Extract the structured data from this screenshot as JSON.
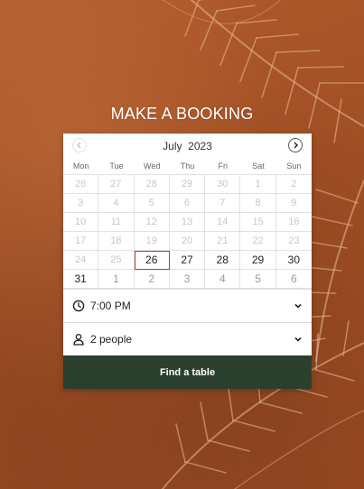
{
  "page": {
    "title": "MAKE A BOOKING"
  },
  "calendar": {
    "month_label": "July  2023",
    "weekdays": [
      "Mon",
      "Tue",
      "Wed",
      "Thu",
      "Fri",
      "Sat",
      "Sun"
    ],
    "days": [
      "26",
      "27",
      "28",
      "29",
      "30",
      "1",
      "2",
      "3",
      "4",
      "5",
      "6",
      "7",
      "8",
      "9",
      "10",
      "11",
      "12",
      "13",
      "14",
      "15",
      "16",
      "17",
      "18",
      "19",
      "20",
      "21",
      "22",
      "23",
      "24",
      "25",
      "26",
      "27",
      "28",
      "29",
      "30",
      "31",
      "1",
      "2",
      "3",
      "4",
      "5",
      "6"
    ],
    "selected_index": 30
  },
  "time": {
    "value": "7:00 PM"
  },
  "party": {
    "value": "2 people"
  },
  "submit": {
    "label": "Find a table"
  },
  "colors": {
    "button": "#2b3f2f",
    "background": "#a65226",
    "selected_border": "#c0392b"
  },
  "icons": {
    "prev": "chevron-left-icon",
    "next": "chevron-right-icon",
    "time": "clock-icon",
    "party": "person-icon",
    "dropdown": "chevron-down-icon"
  }
}
